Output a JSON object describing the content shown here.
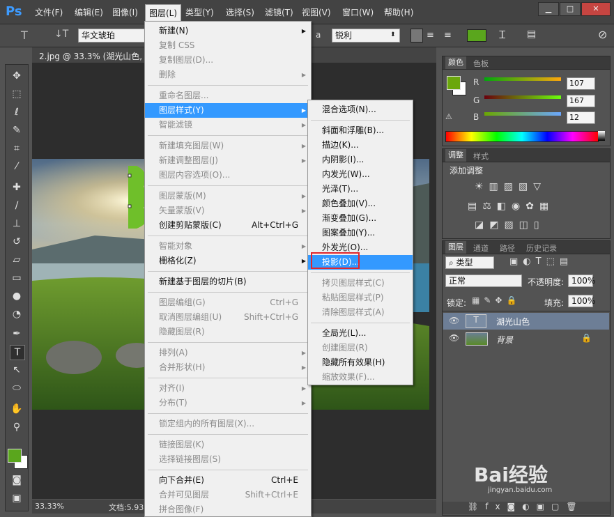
{
  "app": {
    "logo": "Ps"
  },
  "menubar": {
    "items": [
      "文件(F)",
      "编辑(E)",
      "图像(I)",
      "图层(L)",
      "类型(Y)",
      "选择(S)",
      "滤镜(T)",
      "视图(V)",
      "窗口(W)",
      "帮助(H)"
    ],
    "active": "图层(L)"
  },
  "window_controls": {
    "minimize": "▁",
    "maximize": "□",
    "close": "✕"
  },
  "options": {
    "font_family": "华文琥珀",
    "aa_label": "a",
    "aa_value": "锐利",
    "color": "#5aa61d"
  },
  "document": {
    "tab": "2.jpg @ 33.3% (湖光山色, R",
    "zoom": "33.33%",
    "status": "文档:5.93"
  },
  "color_panel": {
    "tabs": [
      "颜色",
      "色板"
    ],
    "r_label": "R",
    "g_label": "G",
    "b_label": "B",
    "r": "107",
    "g": "167",
    "b": "12",
    "fg": "#6ba70c"
  },
  "adjust_panel": {
    "tabs": [
      "调整",
      "样式"
    ],
    "title": "添加调整"
  },
  "layers_panel": {
    "tabs": [
      "图层",
      "通道",
      "路径",
      "历史记录"
    ],
    "filter": "类型",
    "blend": "正常",
    "opacity_label": "不透明度:",
    "opacity": "100%",
    "lock_label": "锁定:",
    "fill_label": "填充:",
    "fill": "100%",
    "layers": [
      {
        "name": "湖光山色",
        "selected": true
      },
      {
        "name": "背景",
        "selected": false
      }
    ]
  },
  "layer_menu": [
    {
      "label": "新建(N)",
      "arrow": true
    },
    {
      "label": "复制 CSS",
      "dis": true
    },
    {
      "label": "复制图层(D)...",
      "dis": true
    },
    {
      "label": "删除",
      "dis": true,
      "arrow": true
    },
    {
      "sep": true
    },
    {
      "label": "重命名图层...",
      "dis": true
    },
    {
      "label": "图层样式(Y)",
      "arrow": true,
      "hi": true
    },
    {
      "label": "智能滤镜",
      "dis": true,
      "arrow": true
    },
    {
      "sep": true
    },
    {
      "label": "新建填充图层(W)",
      "dis": true,
      "arrow": true
    },
    {
      "label": "新建调整图层(J)",
      "dis": true,
      "arrow": true
    },
    {
      "label": "图层内容选项(O)...",
      "dis": true
    },
    {
      "sep": true
    },
    {
      "label": "图层蒙版(M)",
      "dis": true,
      "arrow": true
    },
    {
      "label": "矢量蒙版(V)",
      "dis": true,
      "arrow": true
    },
    {
      "label": "创建剪贴蒙版(C)",
      "sc": "Alt+Ctrl+G"
    },
    {
      "sep": true
    },
    {
      "label": "智能对象",
      "dis": true,
      "arrow": true
    },
    {
      "label": "栅格化(Z)",
      "arrow": true
    },
    {
      "sep": true
    },
    {
      "label": "新建基于图层的切片(B)"
    },
    {
      "sep": true
    },
    {
      "label": "图层编组(G)",
      "dis": true,
      "sc": "Ctrl+G"
    },
    {
      "label": "取消图层编组(U)",
      "dis": true,
      "sc": "Shift+Ctrl+G"
    },
    {
      "label": "隐藏图层(R)",
      "dis": true
    },
    {
      "sep": true
    },
    {
      "label": "排列(A)",
      "dis": true,
      "arrow": true
    },
    {
      "label": "合并形状(H)",
      "dis": true,
      "arrow": true
    },
    {
      "sep": true
    },
    {
      "label": "对齐(I)",
      "dis": true,
      "arrow": true
    },
    {
      "label": "分布(T)",
      "dis": true,
      "arrow": true
    },
    {
      "sep": true
    },
    {
      "label": "锁定组内的所有图层(X)...",
      "dis": true
    },
    {
      "sep": true
    },
    {
      "label": "链接图层(K)",
      "dis": true
    },
    {
      "label": "选择链接图层(S)",
      "dis": true
    },
    {
      "sep": true
    },
    {
      "label": "向下合并(E)",
      "sc": "Ctrl+E"
    },
    {
      "label": "合并可见图层",
      "dis": true,
      "sc": "Shift+Ctrl+E"
    },
    {
      "label": "拼合图像(F)",
      "dis": true
    }
  ],
  "style_submenu": [
    {
      "label": "混合选项(N)..."
    },
    {
      "sep": true
    },
    {
      "label": "斜面和浮雕(B)..."
    },
    {
      "label": "描边(K)..."
    },
    {
      "label": "内阴影(I)..."
    },
    {
      "label": "内发光(W)..."
    },
    {
      "label": "光泽(T)..."
    },
    {
      "label": "颜色叠加(V)..."
    },
    {
      "label": "渐变叠加(G)..."
    },
    {
      "label": "图案叠加(Y)..."
    },
    {
      "label": "外发光(O)..."
    },
    {
      "label": "投影(D)...",
      "hi": true
    },
    {
      "sep": true
    },
    {
      "label": "拷贝图层样式(C)",
      "dis": true
    },
    {
      "label": "粘贴图层样式(P)",
      "dis": true
    },
    {
      "label": "清除图层样式(A)",
      "dis": true
    },
    {
      "sep": true
    },
    {
      "label": "全局光(L)..."
    },
    {
      "label": "创建图层(R)",
      "dis": true
    },
    {
      "label": "隐藏所有效果(H)"
    },
    {
      "label": "缩放效果(F)...",
      "dis": true
    }
  ],
  "watermark": {
    "text": "Bai经验",
    "sub": "jingyan.baidu.com"
  }
}
